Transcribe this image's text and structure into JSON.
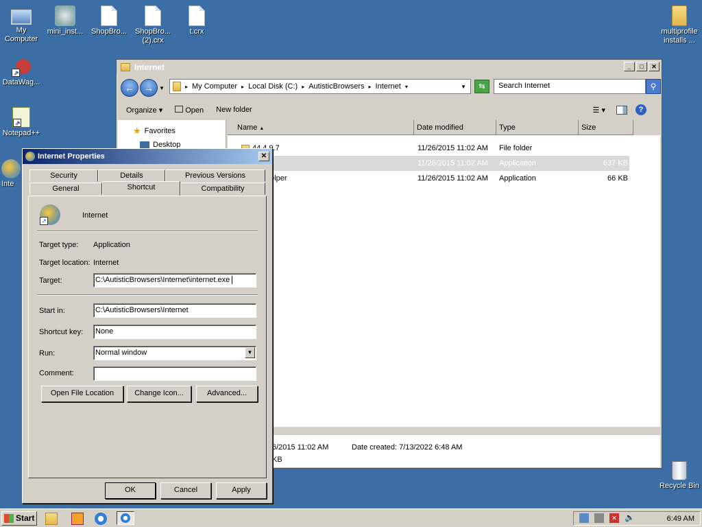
{
  "desktop": {
    "icons": [
      {
        "label": "My\nComputer"
      },
      {
        "label": "mini_inst..."
      },
      {
        "label": "ShopBro..."
      },
      {
        "label": "ShopBro...\n(2).crx"
      },
      {
        "label": "t.crx"
      },
      {
        "label": "multiprofile\ninstalls ..."
      },
      {
        "label": "DataWag..."
      },
      {
        "label": "Notepad++"
      },
      {
        "label": "Inte"
      },
      {
        "label": "Recycle Bin"
      }
    ]
  },
  "explorer": {
    "title": "Internet",
    "breadcrumbs": [
      "My Computer",
      "Local Disk (C:)",
      "AutisticBrowsers",
      "Internet"
    ],
    "search_placeholder": "Search Internet",
    "toolbar": {
      "organize": "Organize",
      "open": "Open",
      "new_folder": "New folder"
    },
    "nav": {
      "favorites": "Favorites",
      "desktop": "Desktop"
    },
    "columns": {
      "name": "Name",
      "date": "Date modified",
      "type": "Type",
      "size": "Size"
    },
    "files": [
      {
        "name": "44.4.9.7",
        "date": "11/26/2015 11:02 AM",
        "type": "File folder",
        "size": ""
      },
      {
        "name": "et",
        "date": "11/26/2015 11:02 AM",
        "type": "Application",
        "size": "637 KB"
      },
      {
        "name": "helper",
        "date": "11/26/2015 11:02 AM",
        "type": "Application",
        "size": "66 KB"
      }
    ],
    "details": {
      "modified": "6/2015 11:02 AM",
      "created": "Date created:  7/13/2022 6:48 AM",
      "size": "KB"
    }
  },
  "dialog": {
    "title": "Internet Properties",
    "tabs_top": [
      "Security",
      "Details",
      "Previous Versions"
    ],
    "tabs_bottom": [
      "General",
      "Shortcut",
      "Compatibility"
    ],
    "name": "Internet",
    "target_type_label": "Target type:",
    "target_type": "Application",
    "target_location_label": "Target location:",
    "target_location": "Internet",
    "target_label": "Target:",
    "target": "C:\\AutisticBrowsers\\Internet\\internet.exe",
    "start_in_label": "Start in:",
    "start_in": "C:\\AutisticBrowsers\\Internet",
    "shortcut_key_label": "Shortcut key:",
    "shortcut_key": "None",
    "run_label": "Run:",
    "run": "Normal window",
    "comment_label": "Comment:",
    "comment": "",
    "btn_open_location": "Open File Location",
    "btn_change_icon": "Change Icon...",
    "btn_advanced": "Advanced...",
    "btn_ok": "OK",
    "btn_cancel": "Cancel",
    "btn_apply": "Apply"
  },
  "taskbar": {
    "start": "Start",
    "clock": "6:49 AM"
  },
  "colors": {
    "desktop": "#3a6ea5",
    "window": "#d4d0c8",
    "title_active": "#0a246a"
  }
}
